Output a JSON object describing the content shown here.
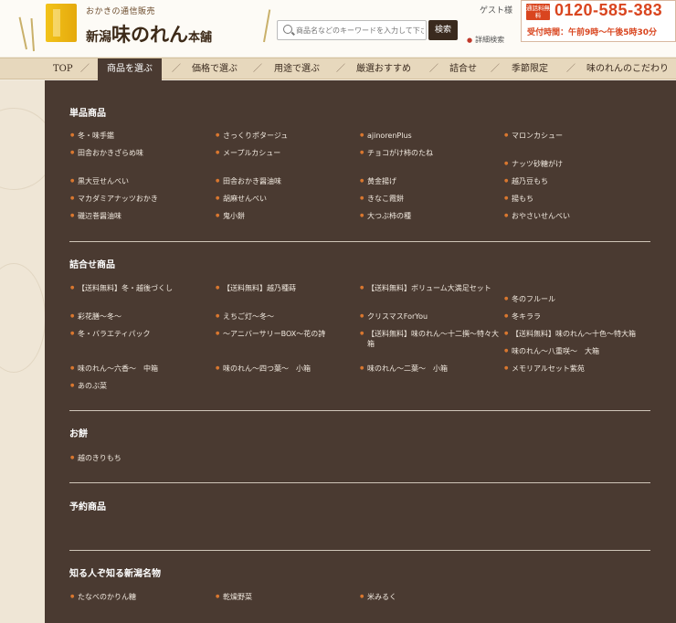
{
  "header": {
    "tagline": "おかきの通信販売",
    "brand_prefix": "新潟",
    "brand_main": "味のれん",
    "brand_suffix": "本舗",
    "search_placeholder": "商品名などのキーワードを入力して下さい",
    "search_button": "検索",
    "guest_label": "ゲスト様",
    "advanced_search": "詳細検索",
    "free_call_label": "通話料無料",
    "phone": "0120-585-383",
    "hours": "受付時間：午前9時～午後5時30分"
  },
  "nav": {
    "items": [
      {
        "label": "TOP",
        "active": false
      },
      {
        "label": "商品を選ぶ",
        "active": true
      },
      {
        "label": "価格で選ぶ",
        "active": false
      },
      {
        "label": "用途で選ぶ",
        "active": false
      },
      {
        "label": "厳選おすすめ",
        "active": false
      },
      {
        "label": "詰合せ",
        "active": false
      },
      {
        "label": "季節限定",
        "active": false
      },
      {
        "label": "味のれんのこだわり",
        "active": false
      }
    ],
    "separator": "／"
  },
  "menu": {
    "sections": [
      {
        "title": "単品商品",
        "items": [
          "冬・味手鑑",
          "さっくりポタージュ",
          "ajinorenPlus",
          "マロンカシュー",
          "田舎おかきざらめ味",
          "メープルカシュー",
          "チョコがけ柿のたね",
          "ナッツ砂糖がけ",
          "黒大豆せんべい",
          "田舎おかき醤油味",
          "黄金揚げ",
          "越乃豆もち",
          "マカダミアナッツおかき",
          "胡麻せんべい",
          "きなこ霞餅",
          "揚もち",
          "磯辺巻醤油味",
          "鬼小餅",
          "大つぶ柿の種",
          "おやさいせんべい"
        ]
      },
      {
        "title": "詰合せ商品",
        "items": [
          "【送料無料】冬・越後づくし",
          "【送料無料】越乃種蒔",
          "【送料無料】ボリューム大満足セット",
          "冬のフルール",
          "彩花膳～冬～",
          "えちご灯～冬～",
          "クリスマスForYou",
          "冬キララ",
          "冬・バラエティパック",
          "～アニバーサリーBOX～花の詩",
          "【送料無料】味のれん～十二撰～特々大箱",
          "【送料無料】味のれん～十色～特大箱",
          "味のれん～八重咲～　大箱",
          "味のれん～六香～　中箱",
          "味のれん～四つ葉～　小箱",
          "味のれん～二葉～　小箱",
          "メモリアルセット紫苑",
          "あのぶ菜"
        ]
      },
      {
        "title": "お餅",
        "items": [
          "越のきりもち"
        ]
      },
      {
        "title": "予約商品",
        "items": []
      },
      {
        "title": "知る人ぞ知る新潟名物",
        "items": [
          "たなべのかりん糖",
          "乾燥野菜",
          "米みるく"
        ]
      }
    ]
  }
}
